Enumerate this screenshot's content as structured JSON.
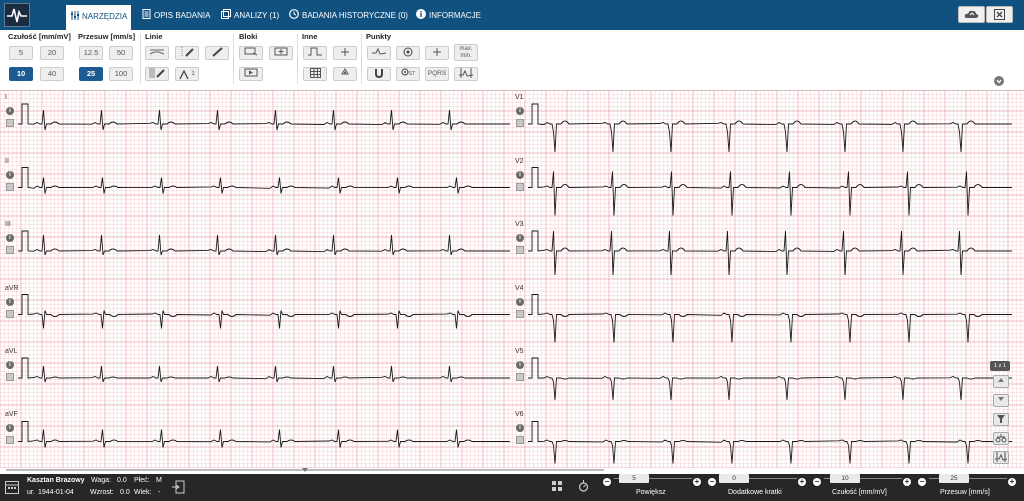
{
  "nav": {
    "tabs": [
      {
        "label": "NARZĘDZIA",
        "icon": "sliders-icon"
      },
      {
        "label": "OPIS BADANIA",
        "icon": "document-icon"
      },
      {
        "label": "ANALIZY (1)",
        "icon": "windows-icon"
      },
      {
        "label": "BADANIA HISTORYCZNE (0)",
        "icon": "clock-icon"
      },
      {
        "label": "INFORMACJE",
        "icon": "info-icon"
      }
    ],
    "active_tab": "NARZĘDZIA"
  },
  "toolbar": {
    "czulosc": {
      "label": "Czułość [mm/mV]",
      "options": [
        "5",
        "20",
        "10",
        "40"
      ],
      "selected": "10"
    },
    "przesuw": {
      "label": "Przesuw [mm/s]",
      "options": [
        "12.5",
        "50",
        "25",
        "100"
      ],
      "selected": "25"
    },
    "linie_label": "Linie",
    "linie_superscript": "1",
    "bloki_label": "Bloki",
    "inne_label": "Inne",
    "punkty_label": "Punkty",
    "maxmin_top": "max.",
    "maxmin_bottom": "min.",
    "st_label": "ST",
    "pqrs_label": "PQRS"
  },
  "leads_left": [
    "I",
    "II",
    "III",
    "aVR",
    "aVL",
    "aVF"
  ],
  "leads_right": [
    "V1",
    "V2",
    "V3",
    "V4",
    "V5",
    "V6"
  ],
  "side": {
    "page_indicator": "1 z 1"
  },
  "patient": {
    "name": "Kasztan Brazowy",
    "weight_label": "Waga:",
    "weight": "0.0",
    "sex_label": "Płeć:",
    "sex": "M",
    "birth_label": "ur.",
    "birth": "1944-01-04",
    "height_label": "Wzrost:",
    "height": "0.0",
    "age_label": "Wiek:",
    "age": "-"
  },
  "controls": [
    {
      "label": "Powiększ",
      "value": "5"
    },
    {
      "label": "Dodatkowe kratki",
      "value": "0"
    },
    {
      "label": "Czułość [mm/mV]",
      "value": "10"
    },
    {
      "label": "Przesuw [mm/s]",
      "value": "25"
    }
  ],
  "colors": {
    "header": "#11517f",
    "selected": "#1e5b93",
    "grid_minor": "#f6cfd2",
    "grid_major": "#e8a5ab",
    "trace": "#1a1a1a",
    "status_bar": "#272727"
  }
}
